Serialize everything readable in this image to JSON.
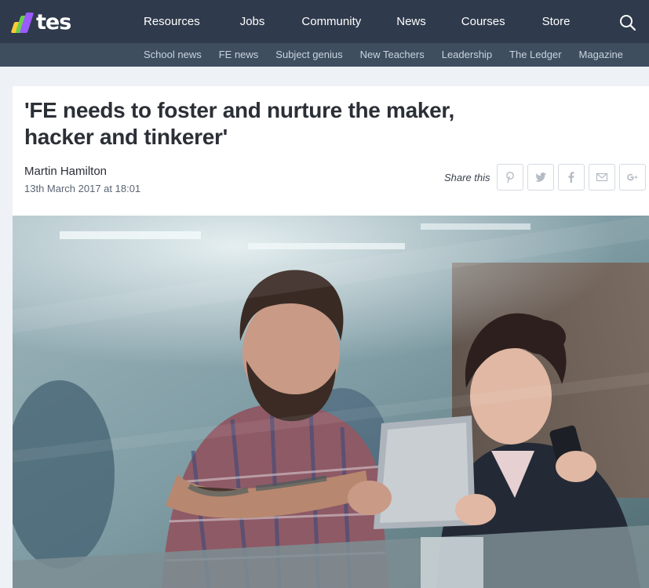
{
  "brand": {
    "name": "tes"
  },
  "nav": {
    "main": [
      "Resources",
      "Jobs",
      "Community",
      "News",
      "Courses",
      "Store"
    ],
    "sub": [
      "School news",
      "FE news",
      "Subject genius",
      "New Teachers",
      "Leadership",
      "The Ledger",
      "Magazine"
    ]
  },
  "article": {
    "title_line1": "'FE needs to foster and nurture the maker,",
    "title_line2": "hacker and tinkerer'",
    "author": "Martin Hamilton",
    "date": "13th March 2017 at 18:01"
  },
  "share": {
    "label": "Share this",
    "icons": [
      "pinterest-icon",
      "twitter-icon",
      "facebook-icon",
      "email-icon",
      "google-plus-icon"
    ]
  },
  "colors": {
    "topbar": "#2f3a4c",
    "subbar": "#3e4e5f",
    "page_bg": "#eef1f5"
  }
}
